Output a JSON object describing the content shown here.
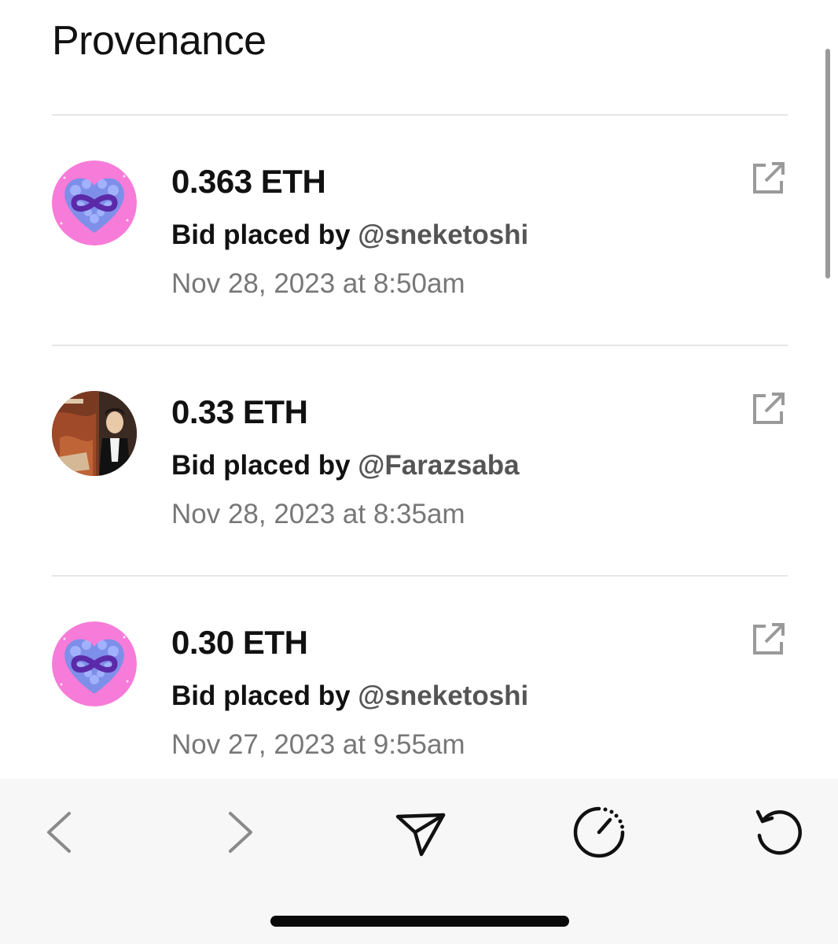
{
  "page": {
    "title": "Provenance"
  },
  "bids": [
    {
      "amount": "0.363 ETH",
      "prefix": "Bid placed by",
      "handle": "@sneketoshi",
      "date": "Nov 28, 2023 at 8:50am",
      "avatar": "heart-infinity-avatar"
    },
    {
      "amount": "0.33 ETH",
      "prefix": "Bid placed by",
      "handle": "@Farazsaba",
      "date": "Nov 28, 2023 at 8:35am",
      "avatar": "painting-portrait-avatar"
    },
    {
      "amount": "0.30 ETH",
      "prefix": "Bid placed by",
      "handle": "@sneketoshi",
      "date": "Nov 27, 2023 at 9:55am",
      "avatar": "heart-infinity-avatar"
    }
  ],
  "toolbar": {
    "items": [
      "back-icon",
      "forward-icon",
      "send-icon",
      "timer-icon",
      "reload-icon"
    ]
  },
  "colors": {
    "text_primary": "#111111",
    "text_handle": "#555555",
    "text_date": "#777777",
    "divider": "#e6e6e6",
    "icon_gray": "#9a9a9a",
    "toolbar_bg": "#f7f7f7"
  }
}
